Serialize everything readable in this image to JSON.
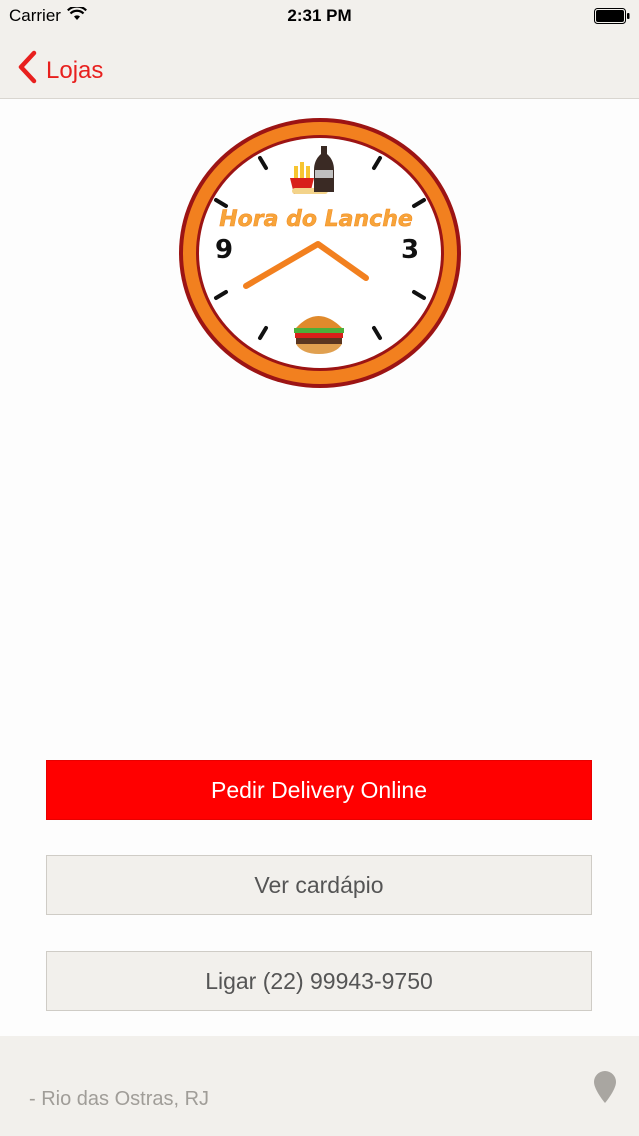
{
  "status_bar": {
    "carrier": "Carrier",
    "time": "2:31 PM"
  },
  "nav": {
    "back_label": "Lojas"
  },
  "logo": {
    "text": "Hora do Lanche",
    "numeral_left": "9",
    "numeral_right": "3"
  },
  "buttons": {
    "delivery": "Pedir Delivery Online",
    "menu": "Ver cardápio",
    "call": "Ligar (22) 99943-9750"
  },
  "footer": {
    "address": "- Rio das Ostras, RJ"
  },
  "colors": {
    "accent": "#e8201e",
    "delivery_button": "#ff0000",
    "bar_background": "#f2f0ec"
  }
}
